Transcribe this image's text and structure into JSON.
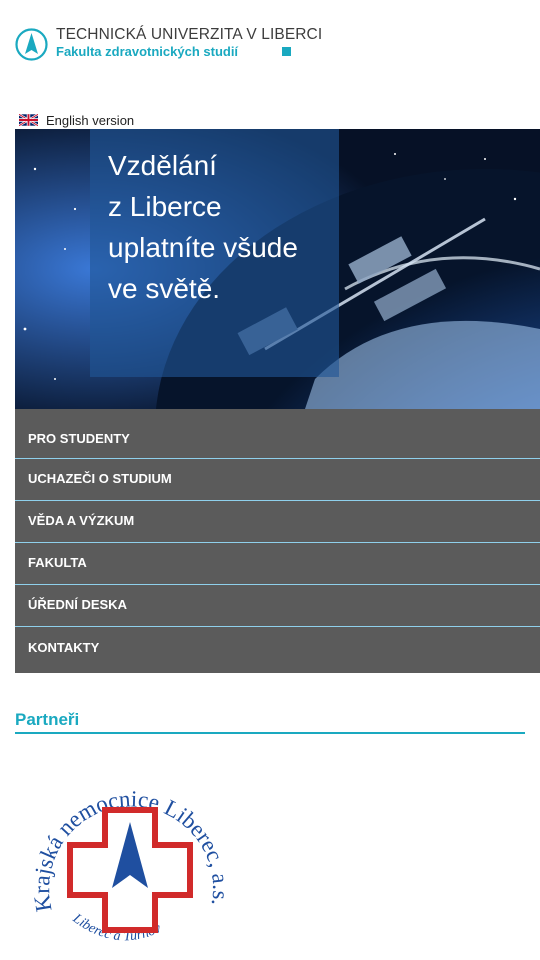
{
  "header": {
    "university": "TECHNICKÁ UNIVERZITA V LIBERCI",
    "faculty": "Fakulta zdravotnických studií",
    "brand_color": "#1aa9c0"
  },
  "language": {
    "label": "English version",
    "icon": "uk-flag-icon"
  },
  "hero": {
    "lines": [
      "Vzdělání",
      "z Liberce",
      "uplatníte všude",
      "ve světě."
    ]
  },
  "nav": {
    "items": [
      {
        "label": "PRO STUDENTY"
      },
      {
        "label": "UCHAZEČI O STUDIUM"
      },
      {
        "label": "VĚDA A VÝZKUM"
      },
      {
        "label": "FAKULTA"
      },
      {
        "label": "ÚŘEDNÍ DESKA"
      },
      {
        "label": "KONTAKTY"
      }
    ],
    "background": "#5b5b5b",
    "divider": "#8fd0ec"
  },
  "partners": {
    "heading": "Partneři",
    "logo": {
      "arc_text": "Krajská nemocnice Liberec, a.s.",
      "sub_text": "Liberec a Turnov",
      "cross_color": "#d12a2a",
      "text_color": "#1f4fa0"
    }
  }
}
